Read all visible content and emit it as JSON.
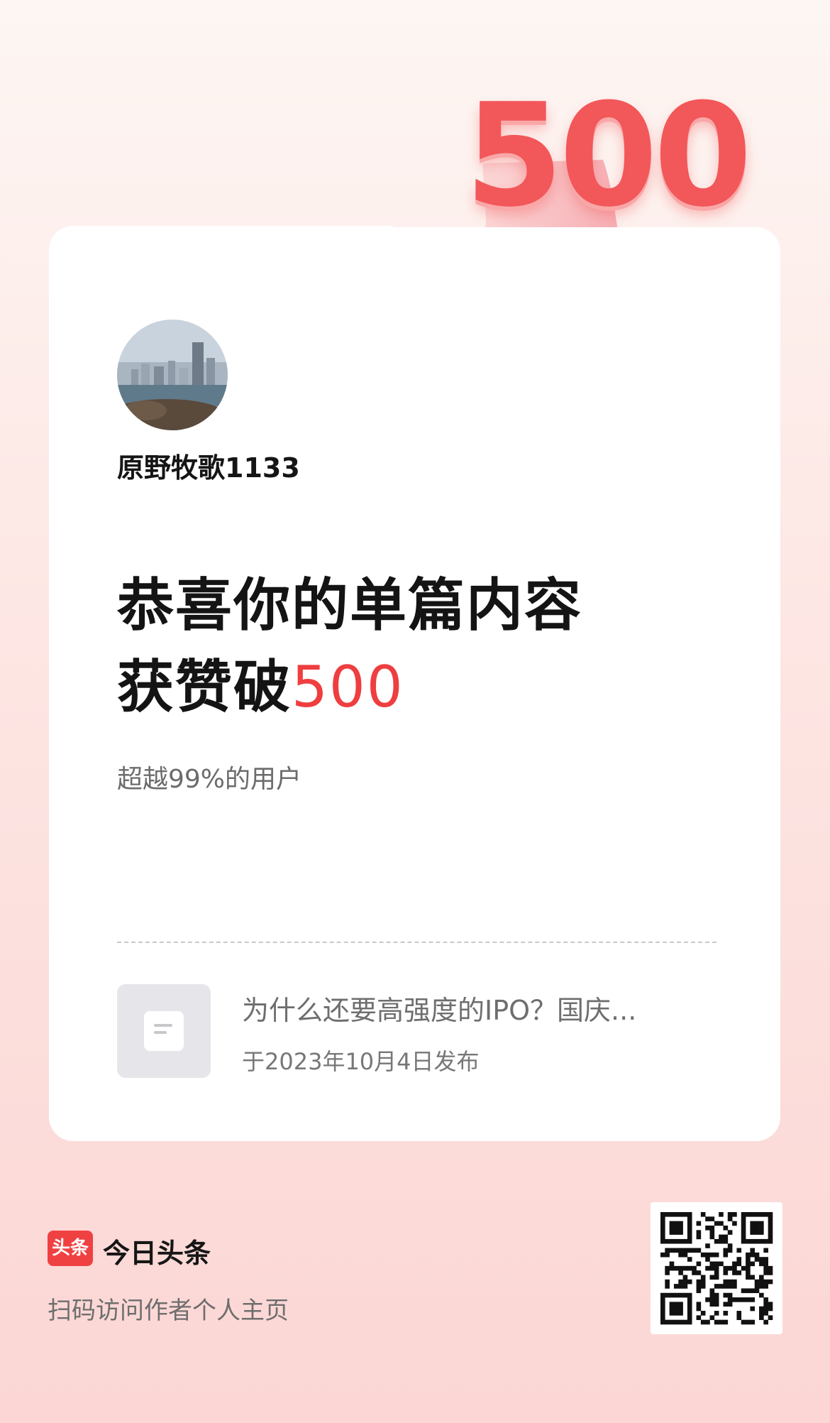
{
  "user": {
    "name": "原野牧歌1133"
  },
  "achievement": {
    "headline_line1": "恭喜你的单篇内容",
    "headline_line2_prefix": "获赞破",
    "count": "500",
    "badge_number": "500",
    "subtitle": "超越99%的用户"
  },
  "article": {
    "title": "为什么还要高强度的IPO？国庆...",
    "date": "于2023年10月4日发布"
  },
  "footer": {
    "logo_text": "头条",
    "app_name": "今日头条",
    "hint": "扫码访问作者个人主页"
  },
  "colors": {
    "accent": "#ef3e40",
    "background_top": "#fdf6f3",
    "background_bottom": "#fbd6d4"
  }
}
